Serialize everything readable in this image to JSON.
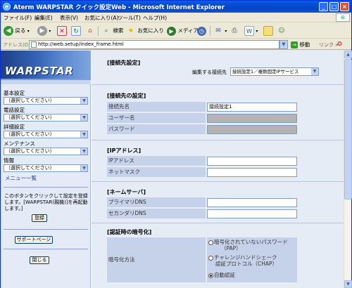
{
  "window": {
    "title": "Aterm WARPSTAR クイック設定Web - Microsoft Internet Explorer",
    "controls": {
      "minimize": "_",
      "maximize": "□",
      "close": "×"
    }
  },
  "menubar": [
    "ファイル(F)",
    "編集(E)",
    "表示(V)",
    "お気に入り(A)",
    "ツール(T)",
    "ヘルプ(H)"
  ],
  "toolbar": {
    "back": "戻る",
    "search": "検索",
    "favorites": "お気に入り",
    "media": "メディア"
  },
  "address": {
    "label": "アドレス(D)",
    "url": "http://web.setup/index_frame.html",
    "go": "移動",
    "links": "リンク"
  },
  "sidebar": {
    "logo": "WARPSTAR",
    "menus": [
      {
        "title": "基本設定",
        "value": "（選択してください）"
      },
      {
        "title": "電話設定",
        "value": "（選択してください）"
      },
      {
        "title": "詳細設定",
        "value": "（選択してください）"
      },
      {
        "title": "メンテナンス",
        "value": "（選択してください）"
      },
      {
        "title": "情報",
        "value": "（選択してください）"
      }
    ],
    "menu_list_link": "メニュー一覧",
    "note": "このボタンをクリックして設定を登録します。[WARPSTAR(親機)]を再起動します。]",
    "register_button": "登録",
    "support_button": "サポートページ",
    "close_button": "閉じる"
  },
  "main": {
    "header_title": "[接続先設定]",
    "edit_target_label": "編集する接続先",
    "edit_target_value": "接続設定1／複数固定IPサービス",
    "connection": {
      "title": "[接続先の設定]",
      "rows": [
        {
          "label": "接続先名",
          "value": "接続設定1",
          "disabled": false
        },
        {
          "label": "ユーザー名",
          "value": "",
          "disabled": true
        },
        {
          "label": "パスワード",
          "value": "",
          "disabled": true
        }
      ]
    },
    "ip": {
      "title": "[IPアドレス]",
      "rows": [
        {
          "label": "IPアドレス",
          "value": ""
        },
        {
          "label": "ネットマスク",
          "value": ""
        }
      ]
    },
    "dns": {
      "title": "[ネームサーバ]",
      "rows": [
        {
          "label": "プライマリDNS",
          "value": ""
        },
        {
          "label": "セカンダリDNS",
          "value": ""
        }
      ]
    },
    "auth": {
      "title": "[認証時の暗号化]",
      "label": "暗号化方法",
      "options": [
        {
          "line1": "暗号化されていないパスワード",
          "line2": "（PAP）",
          "selected": false
        },
        {
          "line1": "チャレンジハンドシェーク",
          "line2": "認証プロトコル（CHAP）",
          "selected": false
        },
        {
          "line1": "自動認証",
          "line2": "",
          "selected": true
        }
      ]
    }
  }
}
